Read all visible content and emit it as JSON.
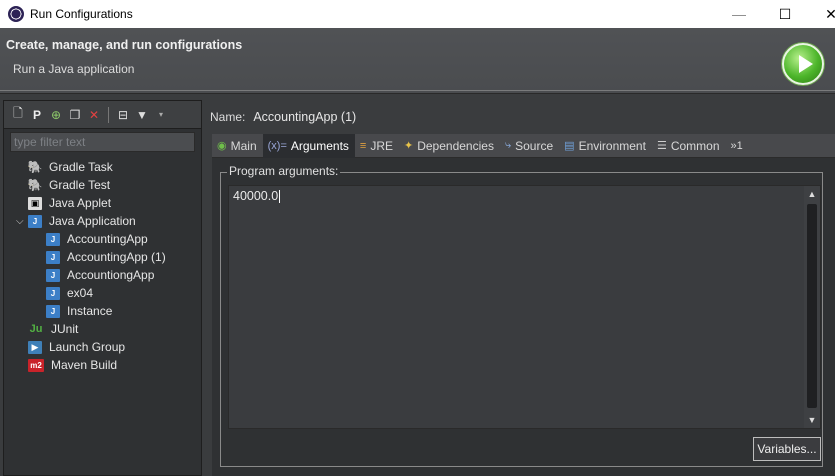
{
  "window": {
    "title": "Run Configurations",
    "controls": {
      "minimize": "—",
      "maximize": "☐",
      "close": "✕"
    }
  },
  "banner": {
    "heading": "Create, manage, and run configurations",
    "subheading": "Run a Java application",
    "icon": "run-icon"
  },
  "left_panel": {
    "toolbar_icons": [
      "new-config-icon",
      "new-prototype-icon",
      "export-icon",
      "duplicate-icon",
      "delete-icon",
      "collapse-all-icon",
      "filter-icon"
    ],
    "filter_placeholder": "type filter text",
    "tree": [
      {
        "label": "Gradle Task",
        "icon": "gradle-icon",
        "level": 1
      },
      {
        "label": "Gradle Test",
        "icon": "gradle-icon",
        "level": 1
      },
      {
        "label": "Java Applet",
        "icon": "applet-icon",
        "level": 1
      },
      {
        "label": "Java Application",
        "icon": "java-app-icon",
        "level": 1,
        "expanded": true
      },
      {
        "label": "AccountingApp",
        "icon": "java-app-icon",
        "level": 2
      },
      {
        "label": "AccountingApp (1)",
        "icon": "java-app-icon",
        "level": 2,
        "selected": true
      },
      {
        "label": "AccountiongApp",
        "icon": "java-app-icon",
        "level": 2
      },
      {
        "label": "ex04",
        "icon": "java-app-icon",
        "level": 2
      },
      {
        "label": "Instance",
        "icon": "java-app-icon",
        "level": 2
      },
      {
        "label": "JUnit",
        "icon": "junit-icon",
        "level": 1
      },
      {
        "label": "Launch Group",
        "icon": "launch-group-icon",
        "level": 1
      },
      {
        "label": "Maven Build",
        "icon": "maven-icon",
        "level": 1
      }
    ]
  },
  "config": {
    "name_label": "Name:",
    "name_value": "AccountingApp (1)",
    "tabs": [
      {
        "label": "Main",
        "icon": "main-tab-icon"
      },
      {
        "label": "Arguments",
        "icon": "arguments-tab-icon",
        "active": true
      },
      {
        "label": "JRE",
        "icon": "jre-tab-icon"
      },
      {
        "label": "Dependencies",
        "icon": "dependencies-tab-icon"
      },
      {
        "label": "Source",
        "icon": "source-tab-icon"
      },
      {
        "label": "Environment",
        "icon": "environment-tab-icon"
      },
      {
        "label": "Common",
        "icon": "common-tab-icon"
      }
    ],
    "overflow_label": "»1",
    "program_arguments_label": "Program arguments:",
    "program_arguments_value": "40000.0",
    "variables_button": "Variables..."
  }
}
